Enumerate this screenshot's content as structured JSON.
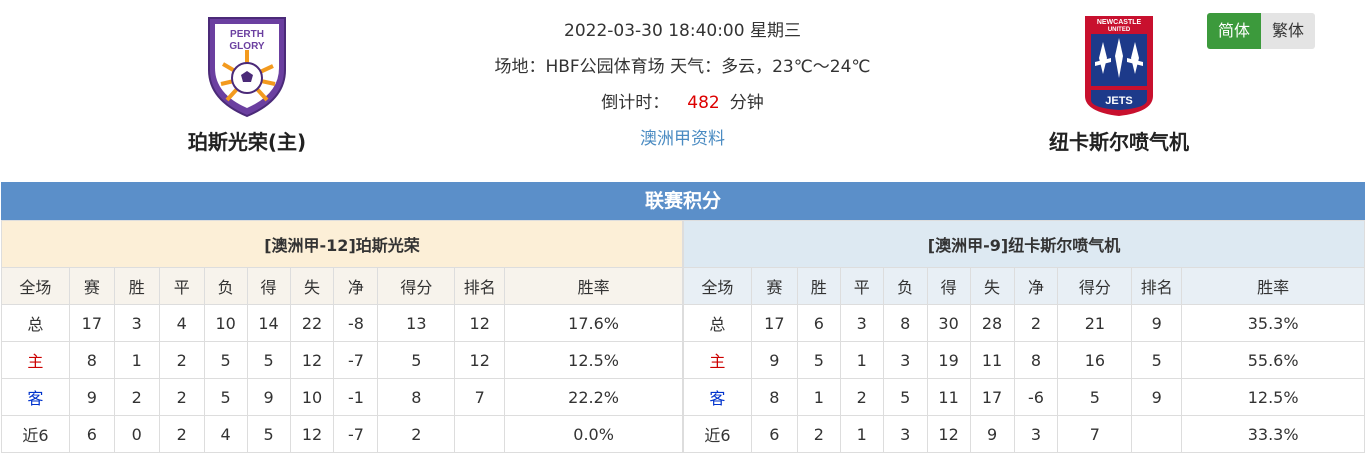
{
  "match": {
    "datetime": "2022-03-30 18:40:00 星期三",
    "venue_line": "场地：HBF公园体育场 天气：多云，23℃～24℃",
    "countdown_label": "倒计时：",
    "countdown_value": "482",
    "countdown_unit": "分钟",
    "league_link": "澳洲甲资料"
  },
  "home_team": {
    "name": "珀斯光荣(主)",
    "logo_text": [
      "PERTH",
      "GLORY"
    ]
  },
  "away_team": {
    "name": "纽卡斯尔喷气机",
    "logo_text": [
      "NEWCASTLE",
      "UNITED",
      "JETS"
    ]
  },
  "lang": {
    "simplified": "简体",
    "traditional": "繁体"
  },
  "standings": {
    "title": "联赛积分",
    "columns": [
      "全场",
      "赛",
      "胜",
      "平",
      "负",
      "得",
      "失",
      "净",
      "得分",
      "排名",
      "胜率"
    ],
    "home": {
      "header": "[澳洲甲-12]珀斯光荣",
      "rows": [
        [
          "总",
          "17",
          "3",
          "4",
          "10",
          "14",
          "22",
          "-8",
          "13",
          "12",
          "17.6%"
        ],
        [
          "主",
          "8",
          "1",
          "2",
          "5",
          "5",
          "12",
          "-7",
          "5",
          "12",
          "12.5%"
        ],
        [
          "客",
          "9",
          "2",
          "2",
          "5",
          "9",
          "10",
          "-1",
          "8",
          "7",
          "22.2%"
        ],
        [
          "近6",
          "6",
          "0",
          "2",
          "4",
          "5",
          "12",
          "-7",
          "2",
          "",
          "0.0%"
        ]
      ]
    },
    "away": {
      "header": "[澳洲甲-9]纽卡斯尔喷气机",
      "rows": [
        [
          "总",
          "17",
          "6",
          "3",
          "8",
          "30",
          "28",
          "2",
          "21",
          "9",
          "35.3%"
        ],
        [
          "主",
          "9",
          "5",
          "1",
          "3",
          "19",
          "11",
          "8",
          "16",
          "5",
          "55.6%"
        ],
        [
          "客",
          "8",
          "1",
          "2",
          "5",
          "11",
          "17",
          "-6",
          "5",
          "9",
          "12.5%"
        ],
        [
          "近6",
          "6",
          "2",
          "1",
          "3",
          "12",
          "9",
          "3",
          "7",
          "",
          "33.3%"
        ]
      ]
    }
  }
}
